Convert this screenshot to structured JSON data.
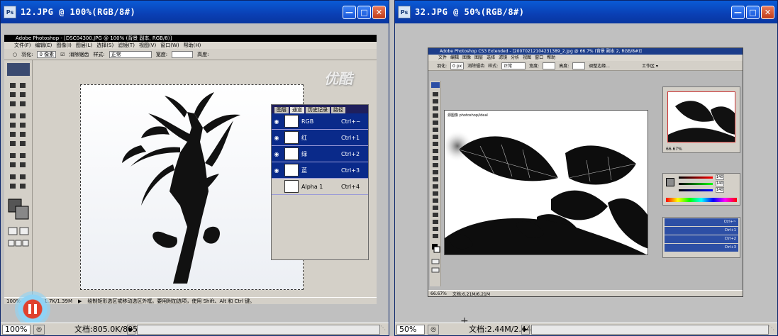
{
  "left_window": {
    "title": "12.JPG @ 100%(RGB/8#)",
    "icon": "Ps",
    "status": {
      "zoom": "100%",
      "doc": "文档:805.0K/805.0K"
    },
    "inner": {
      "title": "Adobe Photoshop - [DSC04300.JPG @ 100% (背景 副本, RGB/8)]",
      "menu": [
        "文件(F)",
        "编辑(E)",
        "图像(I)",
        "图层(L)",
        "选择(S)",
        "滤镜(T)",
        "视图(V)",
        "窗口(W)",
        "帮助(H)"
      ],
      "options": {
        "feather_label": "羽化:",
        "feather_value": "0 像素",
        "antialias": "消除锯齿",
        "style_label": "样式:",
        "style_value": "正常",
        "width_label": "宽度:",
        "height_label": "高度:"
      },
      "status": {
        "zoom": "100%",
        "doc": "文档:611.7K/1.39M",
        "hint": "绘制矩形选区或移动选区外框。要用附加选项，使用 Shift、Alt 和 Ctrl 键。"
      },
      "panel_tabs": [
        "图层",
        "通道",
        "历史记录",
        "路径"
      ],
      "channels": [
        {
          "name": "RGB",
          "key": "Ctrl+~",
          "selected": true
        },
        {
          "name": "红",
          "key": "Ctrl+1",
          "selected": true
        },
        {
          "name": "绿",
          "key": "Ctrl+2",
          "selected": true
        },
        {
          "name": "蓝",
          "key": "Ctrl+3",
          "selected": true
        },
        {
          "name": "Alpha 1",
          "key": "Ctrl+4",
          "selected": false
        }
      ]
    },
    "watermark": "优酷"
  },
  "right_window": {
    "title": "32.JPG @ 50%(RGB/8#)",
    "icon": "Ps",
    "status": {
      "zoom": "50%",
      "doc": "文档:2.44M/2.44M"
    },
    "inner": {
      "title": "Adobe Photoshop CS3 Extended - [20070212104231389_2.jpg @ 66.7% (背景 副本 2, RGB/8#)]",
      "menu": [
        "文件",
        "编辑",
        "图像",
        "图层",
        "选择",
        "滤镜",
        "分析",
        "视图",
        "窗口",
        "帮助"
      ],
      "options": {
        "feather_label": "羽化:",
        "feather_value": "0 px",
        "antialias": "消除锯齿",
        "style_label": "样式:",
        "style_value": "正常",
        "width_label": "宽度:",
        "height_label": "高度:",
        "refine": "调整边缘...",
        "workspace": "工作区 ▾"
      },
      "canvas_caption": "源图像 photoshop/ideal",
      "status": {
        "zoom": "66.67%",
        "doc": "文档:6.21M/6.21M"
      },
      "navigator_zoom": "66.67%",
      "color_values": [
        "140",
        "140",
        "140"
      ],
      "channel_keys": [
        "Ctrl+~",
        "Ctrl+1",
        "Ctrl+2",
        "Ctrl+3"
      ]
    }
  }
}
